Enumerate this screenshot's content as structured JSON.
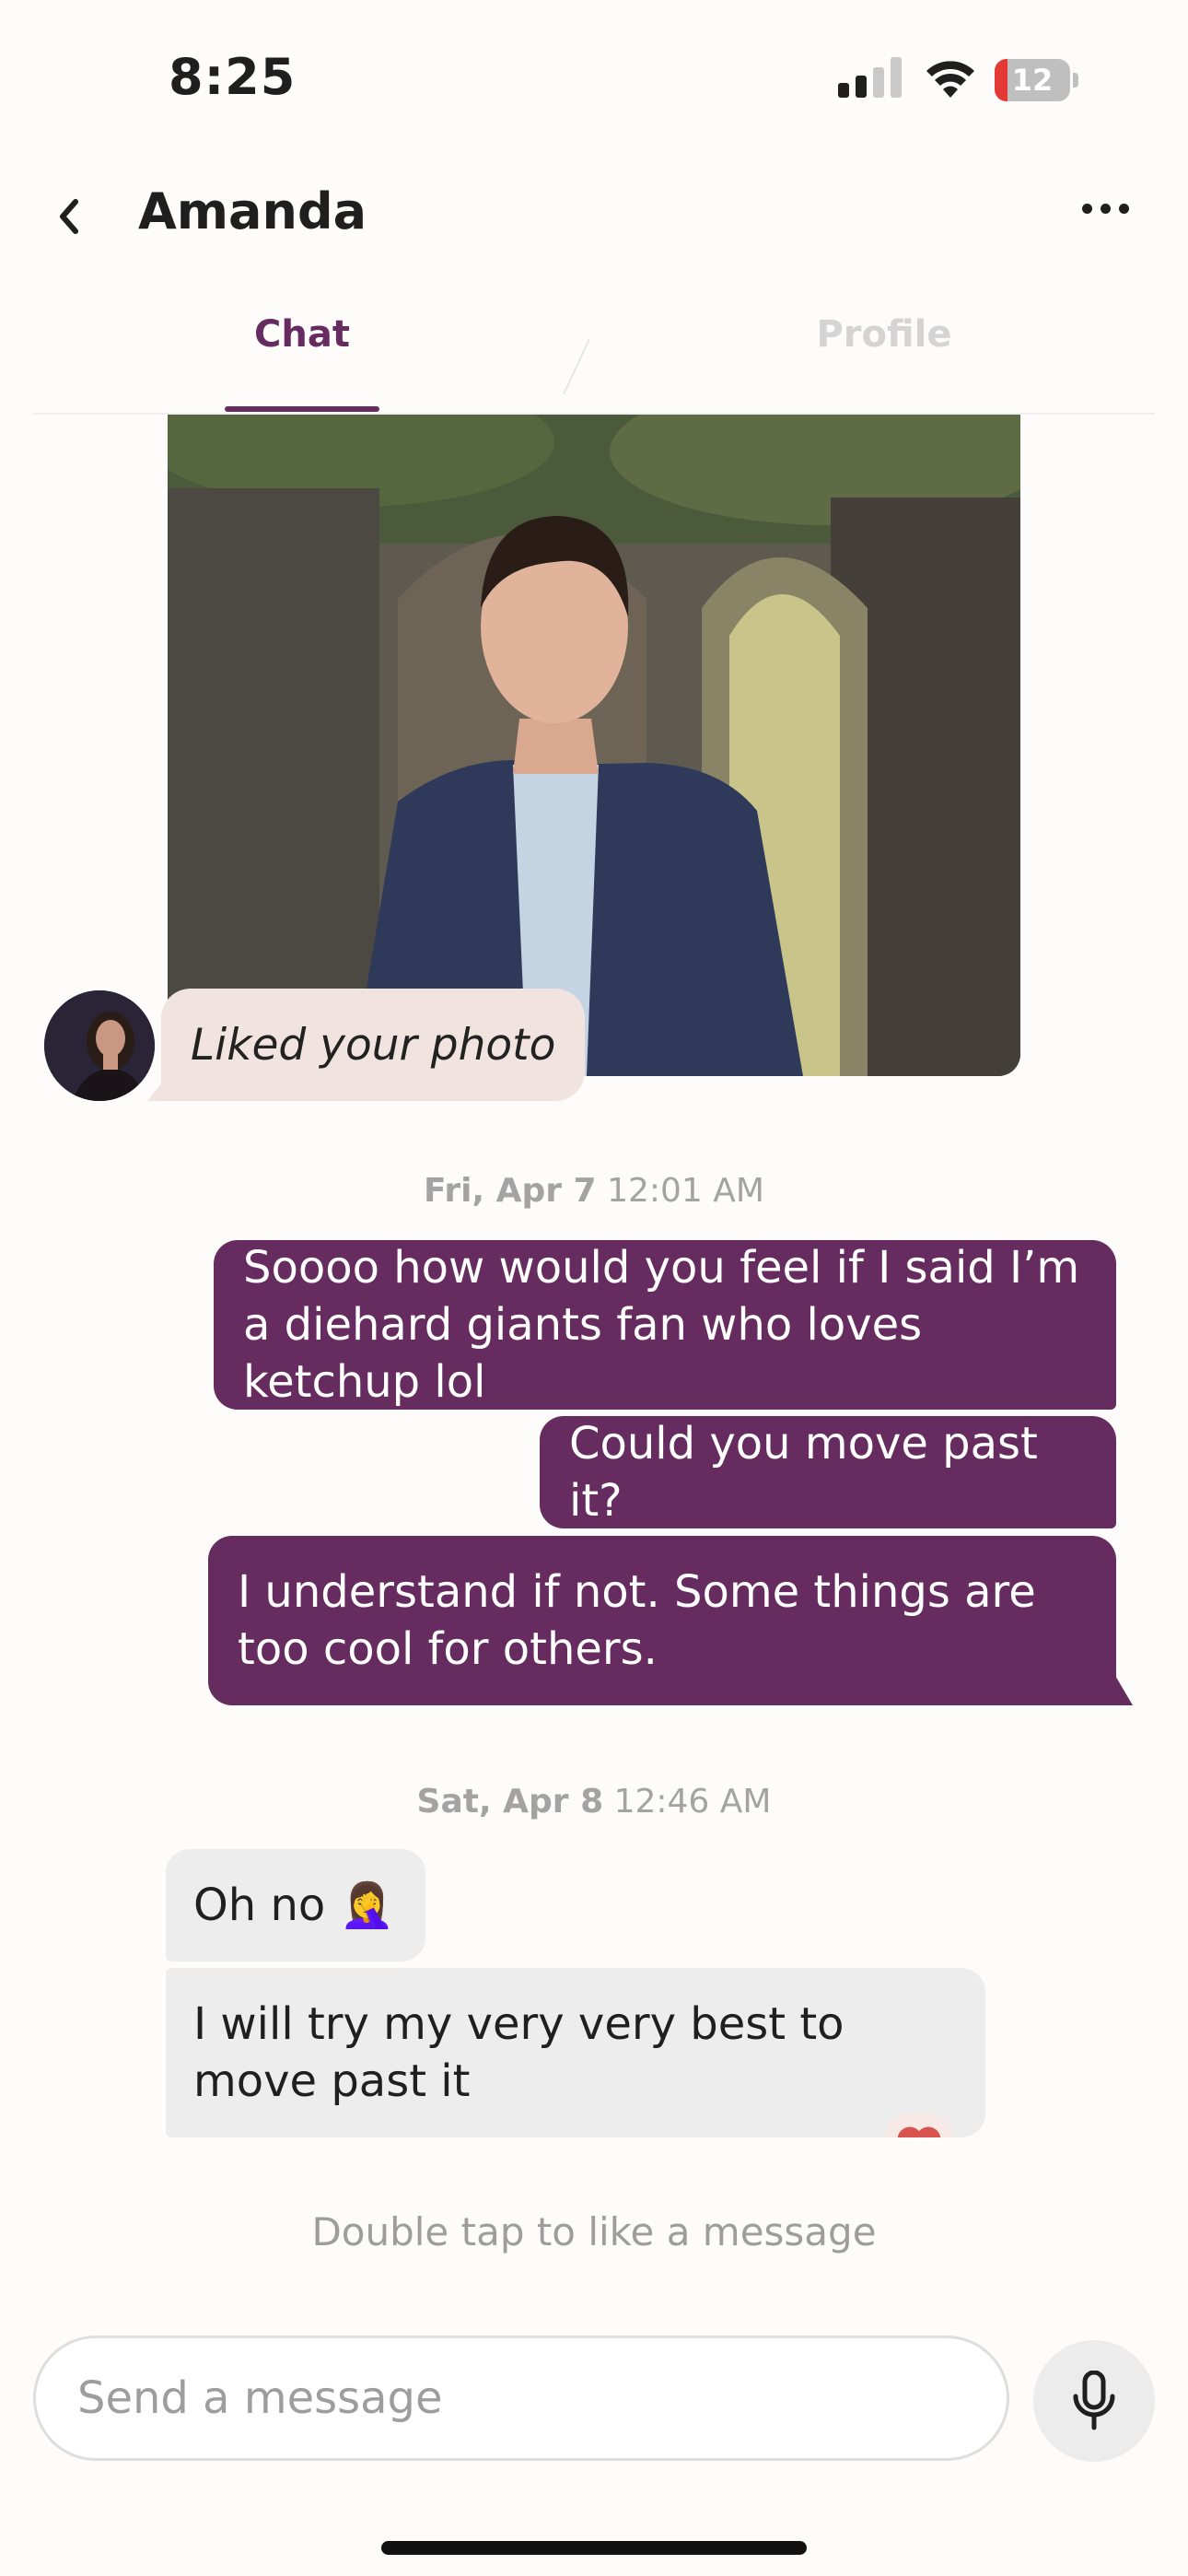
{
  "status_bar": {
    "time": "8:25",
    "battery": "12"
  },
  "header": {
    "title": "Amanda"
  },
  "tabs": [
    {
      "label": "Chat",
      "active": true
    },
    {
      "label": "Profile",
      "active": false
    }
  ],
  "liked_photo": {
    "caption": "Liked your photo"
  },
  "messages": {
    "group1": {
      "date_day": "Fri, Apr 7",
      "date_time": "12:01 AM",
      "outgoing": [
        "Soooo how would you feel if I said I’m a diehard giants fan who loves ketchup lol",
        "Could you move past it?",
        "I understand if not. Some things are too cool for others."
      ]
    },
    "group2": {
      "date_day": "Sat, Apr 8",
      "date_time": "12:46 AM",
      "incoming": [
        "Oh no 🤦‍♀️",
        "I will try my very very best to move past it"
      ]
    }
  },
  "hint": "Double tap to like a message",
  "composer": {
    "placeholder": "Send a message"
  },
  "colors": {
    "accent": "#662b5f",
    "incoming_bubble": "#ededed",
    "liked_bubble": "#f1e3df",
    "heart": "#d9534f"
  },
  "icons": [
    "back-icon",
    "more-icon",
    "signal-icon",
    "wifi-icon",
    "battery-icon",
    "heart-icon",
    "microphone-icon"
  ]
}
